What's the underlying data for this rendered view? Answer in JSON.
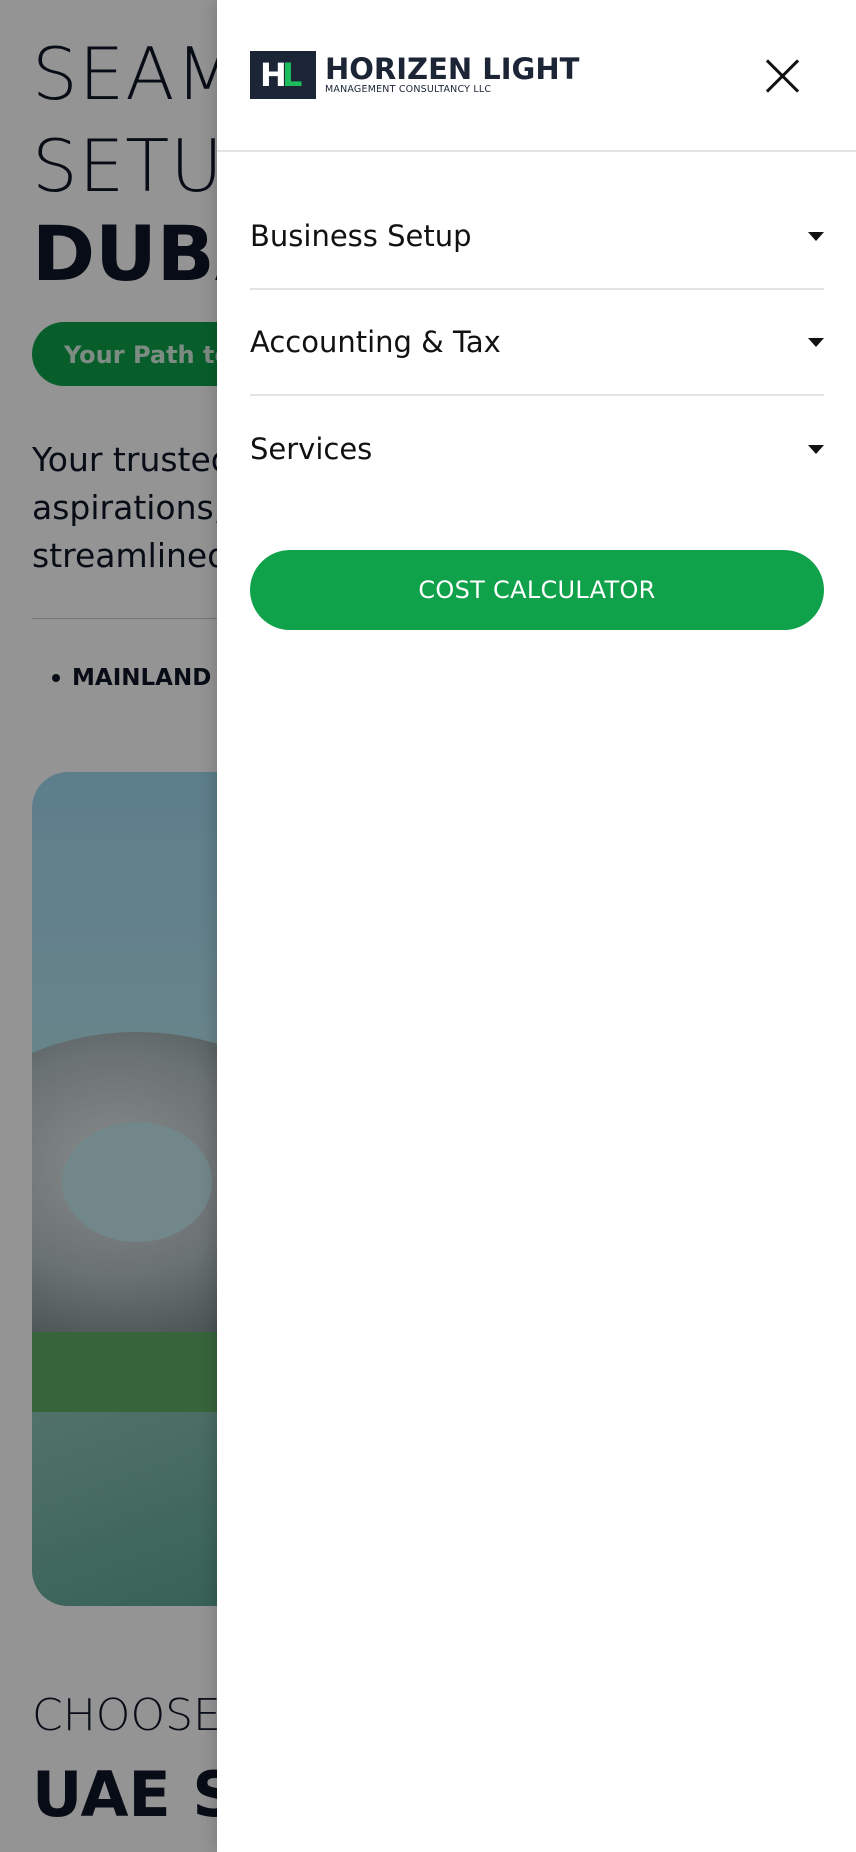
{
  "background": {
    "hero_line1": "SEAMLESS BUSINESS",
    "hero_line2": "SETUP IN",
    "hero_bold": "DUBAI",
    "path_pill": "Your Path to Success",
    "intro_lines": [
      "Your trusted partner for business",
      "aspirations, with expert and",
      "streamlined solutions."
    ],
    "bullet": "MAINLAND",
    "choose_heading": "CHOOSE YOUR",
    "uae_heading": "UAE SETUP"
  },
  "drawer": {
    "logo": {
      "name": "HORIZEN LIGHT",
      "subtitle": "MANAGEMENT CONSULTANCY LLC",
      "mark_h": "H",
      "mark_l": "L"
    },
    "close_icon": "close-icon",
    "menu": [
      {
        "label": "Business Setup",
        "icon": "caret-down-icon"
      },
      {
        "label": "Accounting & Tax",
        "icon": "caret-down-icon"
      },
      {
        "label": "Services",
        "icon": "caret-down-icon"
      }
    ],
    "cta_label": "COST CALCULATOR"
  },
  "colors": {
    "brand_green": "#0fa24a",
    "brand_navy": "#1b2536",
    "logo_green": "#1dbd5d",
    "overlay": "rgba(0,0,0,0.42)"
  }
}
